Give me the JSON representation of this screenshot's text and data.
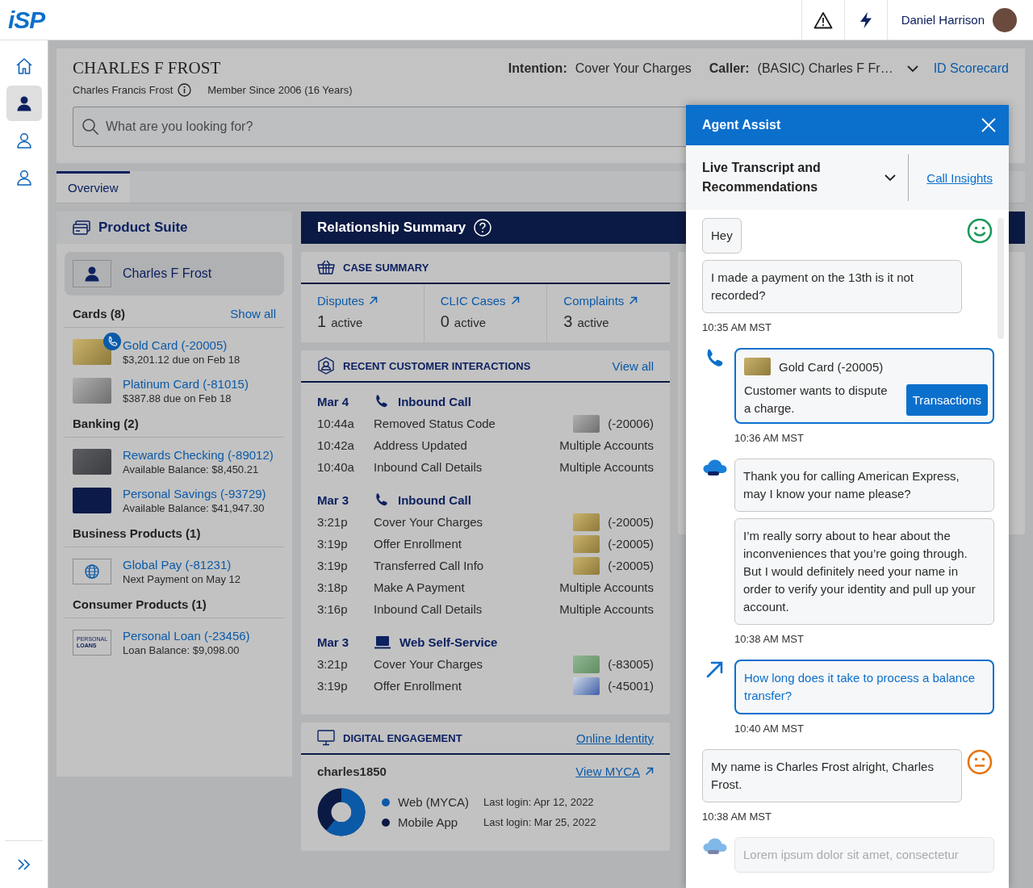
{
  "topbar": {
    "logo": "iSP",
    "user": "Daniel Harrison"
  },
  "rail": [
    {
      "kind": "home",
      "selected": false
    },
    {
      "kind": "person-filled",
      "selected": true
    },
    {
      "kind": "person",
      "selected": false
    },
    {
      "kind": "person",
      "selected": false
    }
  ],
  "header": {
    "name": "CHARLES F FROST",
    "full_name": "Charles Francis Frost",
    "member_since": "Member Since 2006 (16 Years)",
    "intention_label": "Intention:",
    "intention": "Cover Your Charges",
    "caller_label": "Caller:",
    "caller": "(BASIC) Charles F Fr…",
    "scorecard": "ID Scorecard"
  },
  "search": {
    "placeholder": "What are you looking for?"
  },
  "tabs": [
    {
      "label": "Overview",
      "selected": true
    }
  ],
  "product_suite": {
    "title": "Product Suite",
    "customer": "Charles F Frost",
    "sections": [
      {
        "title": "Cards (8)",
        "link": "Show all",
        "items": [
          {
            "kind": "gold",
            "on_call": true,
            "name": "Gold Card (-20005)",
            "detail": "$3,201.12 due on Feb 18"
          },
          {
            "kind": "platinum",
            "on_call": false,
            "name": "Platinum Card (-81015)",
            "detail": "$387.88 due on Feb 18"
          }
        ]
      },
      {
        "title": "Banking (2)",
        "items": [
          {
            "kind": "checking",
            "on_call": false,
            "name": "Rewards Checking (-89012)",
            "detail": "Available Balance: $8,450.21"
          },
          {
            "kind": "savings",
            "on_call": false,
            "name": "Personal Savings (-93729)",
            "detail": "Available Balance: $41,947.30"
          }
        ]
      },
      {
        "title": "Business Products (1)",
        "items": [
          {
            "kind": "globe",
            "on_call": false,
            "name": "Global Pay (-81231)",
            "detail": "Next Payment on May 12"
          }
        ]
      },
      {
        "title": "Consumer Products (1)",
        "items": [
          {
            "kind": "loan",
            "thumb_text": [
              "PERSONAL",
              "LOANS"
            ],
            "on_call": false,
            "name": "Personal Loan (-23456)",
            "detail": "Loan Balance: $9,098.00"
          }
        ]
      }
    ]
  },
  "relationship": {
    "title": "Relationship Summary"
  },
  "case_summary": {
    "title": "CASE SUMMARY",
    "items": [
      {
        "label": "Disputes",
        "count": "1",
        "unit": "active"
      },
      {
        "label": "CLIC Cases",
        "count": "0",
        "unit": "active"
      },
      {
        "label": "Complaints",
        "count": "3",
        "unit": "active"
      }
    ]
  },
  "interactions": {
    "title": "RECENT CUSTOMER INTERACTIONS",
    "link": "View all",
    "groups": [
      {
        "date": "Mar 4",
        "channel": "Inbound Call",
        "kind": "call",
        "rows": [
          {
            "time": "10:44a",
            "activity": "Removed Status Code",
            "kind": "platinum",
            "account": "(-20006)"
          },
          {
            "time": "10:42a",
            "activity": "Address Updated",
            "kind": "plain",
            "account": "Multiple Accounts"
          },
          {
            "time": "10:40a",
            "activity": "Inbound Call Details",
            "kind": "plain",
            "account": "Multiple Accounts"
          }
        ]
      },
      {
        "date": "Mar 3",
        "channel": "Inbound Call",
        "kind": "call",
        "rows": [
          {
            "time": "3:21p",
            "activity": "Cover Your Charges",
            "kind": "gold",
            "account": "(-20005)"
          },
          {
            "time": "3:19p",
            "activity": "Offer Enrollment",
            "kind": "gold",
            "account": "(-20005)"
          },
          {
            "time": "3:19p",
            "activity": "Transferred Call Info",
            "kind": "gold",
            "account": "(-20005)"
          },
          {
            "time": "3:18p",
            "activity": "Make A Payment",
            "kind": "plain",
            "account": "Multiple Accounts"
          },
          {
            "time": "3:16p",
            "activity": "Inbound Call Details",
            "kind": "plain",
            "account": "Multiple Accounts"
          }
        ]
      },
      {
        "date": "Mar 3",
        "channel": "Web Self-Service",
        "kind": "web",
        "rows": [
          {
            "time": "3:21p",
            "activity": "Cover Your Charges",
            "kind": "green",
            "account": "(-83005)"
          },
          {
            "time": "3:19p",
            "activity": "Offer Enrollment",
            "kind": "blue",
            "account": "(-45001)"
          }
        ]
      }
    ]
  },
  "digital": {
    "title": "DIGITAL ENGAGEMENT",
    "link": "Online Identity",
    "username": "charles1850",
    "user_link": "View MYCA",
    "channels": [
      {
        "name": "Web (MYCA)",
        "last_login": "Last login: Apr 12, 2022",
        "color": "#0b5aa8"
      },
      {
        "name": "Mobile App",
        "last_login": "Last login: Mar 25, 2022",
        "color": "#0b1a44"
      }
    ]
  },
  "agent_assist": {
    "title": "Agent Assist",
    "view": "Live Transcript and Recommendations",
    "link": "Call Insights",
    "transcript": [
      {
        "kind": "customer",
        "texts": [
          "Hey",
          "I made a payment on the 13th is it not recorded?"
        ],
        "sentiment": {
          "kind": "positive",
          "color": "#1a9a5a"
        },
        "time": "10:35 AM MST"
      },
      {
        "kind": "recommendation",
        "card": {
          "kind": "gold",
          "name": "Gold Card (-20005)"
        },
        "text": "Customer wants to dispute a charge.",
        "action": "Transactions",
        "time": "10:36 AM MST"
      },
      {
        "kind": "agent",
        "texts": [
          "Thank you for calling American Express, may I know your name please?",
          "I’m really sorry about to hear about the inconveniences that you’re going through. But I would definitely need your name in order to verify your identity and pull up your account."
        ],
        "time": "10:38 AM MST",
        "faded": false
      },
      {
        "kind": "suggestion",
        "text": "How long does it take to process a balance transfer?",
        "time": "10:40 AM MST"
      },
      {
        "kind": "customer",
        "texts": [
          "My name is Charles Frost alright, Charles Frost."
        ],
        "sentiment": {
          "kind": "neutral",
          "color": "#e8730c"
        },
        "time": "10:38 AM MST"
      },
      {
        "kind": "agent",
        "texts": [
          "Lorem ipsum dolor sit amet, consectetur"
        ],
        "faded": true
      }
    ]
  }
}
